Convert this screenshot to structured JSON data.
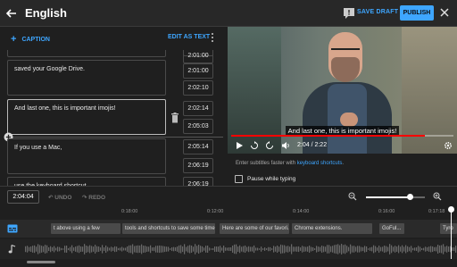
{
  "header": {
    "title": "English",
    "save_draft": "SAVE DRAFT",
    "publish": "PUBLISH"
  },
  "toolbar": {
    "add_caption": "CAPTION",
    "edit_as_text": "EDIT AS TEXT"
  },
  "captions": [
    {
      "text": "",
      "start": "2:01:00",
      "end": ""
    },
    {
      "text": "saved your Google Drive.",
      "start": "2:01:00",
      "end": "2:02:10"
    },
    {
      "text": "And last one, this is important imojis!",
      "start": "2:02:14",
      "end": "2:05:03"
    },
    {
      "text": "If you use a Mac,",
      "start": "2:05:14",
      "end": "2:06:19"
    },
    {
      "text": "use the keyboard shortcut",
      "start": "2:06:19",
      "end": ""
    }
  ],
  "video": {
    "caption_overlay": "And last one, this is important imojis!",
    "time": "2:04 / 2:22",
    "progress": 0.87
  },
  "hint": {
    "prefix": "Enter subtitles faster with ",
    "link": "keyboard shortcuts",
    "suffix": "."
  },
  "pause_while_typing": "Pause while typing",
  "timeline": {
    "current_time": "2:04:04",
    "undo": "UNDO",
    "redo": "REDO",
    "zoom_level": 0.75,
    "ticks": [
      "0:18:00",
      "0:12:00",
      "0:14:00",
      "0:16:00",
      "0:17:18"
    ],
    "caption_chips": [
      "t above using a few",
      "tools and shortcuts to save some time.",
      "Here are some of our favori...",
      "Chrome extensions.",
      "GoFul...",
      "Tyro"
    ]
  },
  "icons": {
    "back": "back-arrow-icon",
    "feedback": "feedback-icon",
    "close": "close-icon",
    "more": "more-vert-icon",
    "trash": "trash-icon",
    "insert": "add-circle-icon",
    "play": "play-icon",
    "rewind": "replay-5-icon",
    "forward": "forward-5-icon",
    "volume": "volume-icon",
    "settings": "settings-icon",
    "zoom_out": "zoom-out-icon",
    "zoom_in": "zoom-in-icon",
    "subtitle_track": "subtitles-icon",
    "audio_track": "music-note-icon"
  },
  "colors": {
    "accent": "#3ea6ff",
    "progress": "#ff0000"
  }
}
